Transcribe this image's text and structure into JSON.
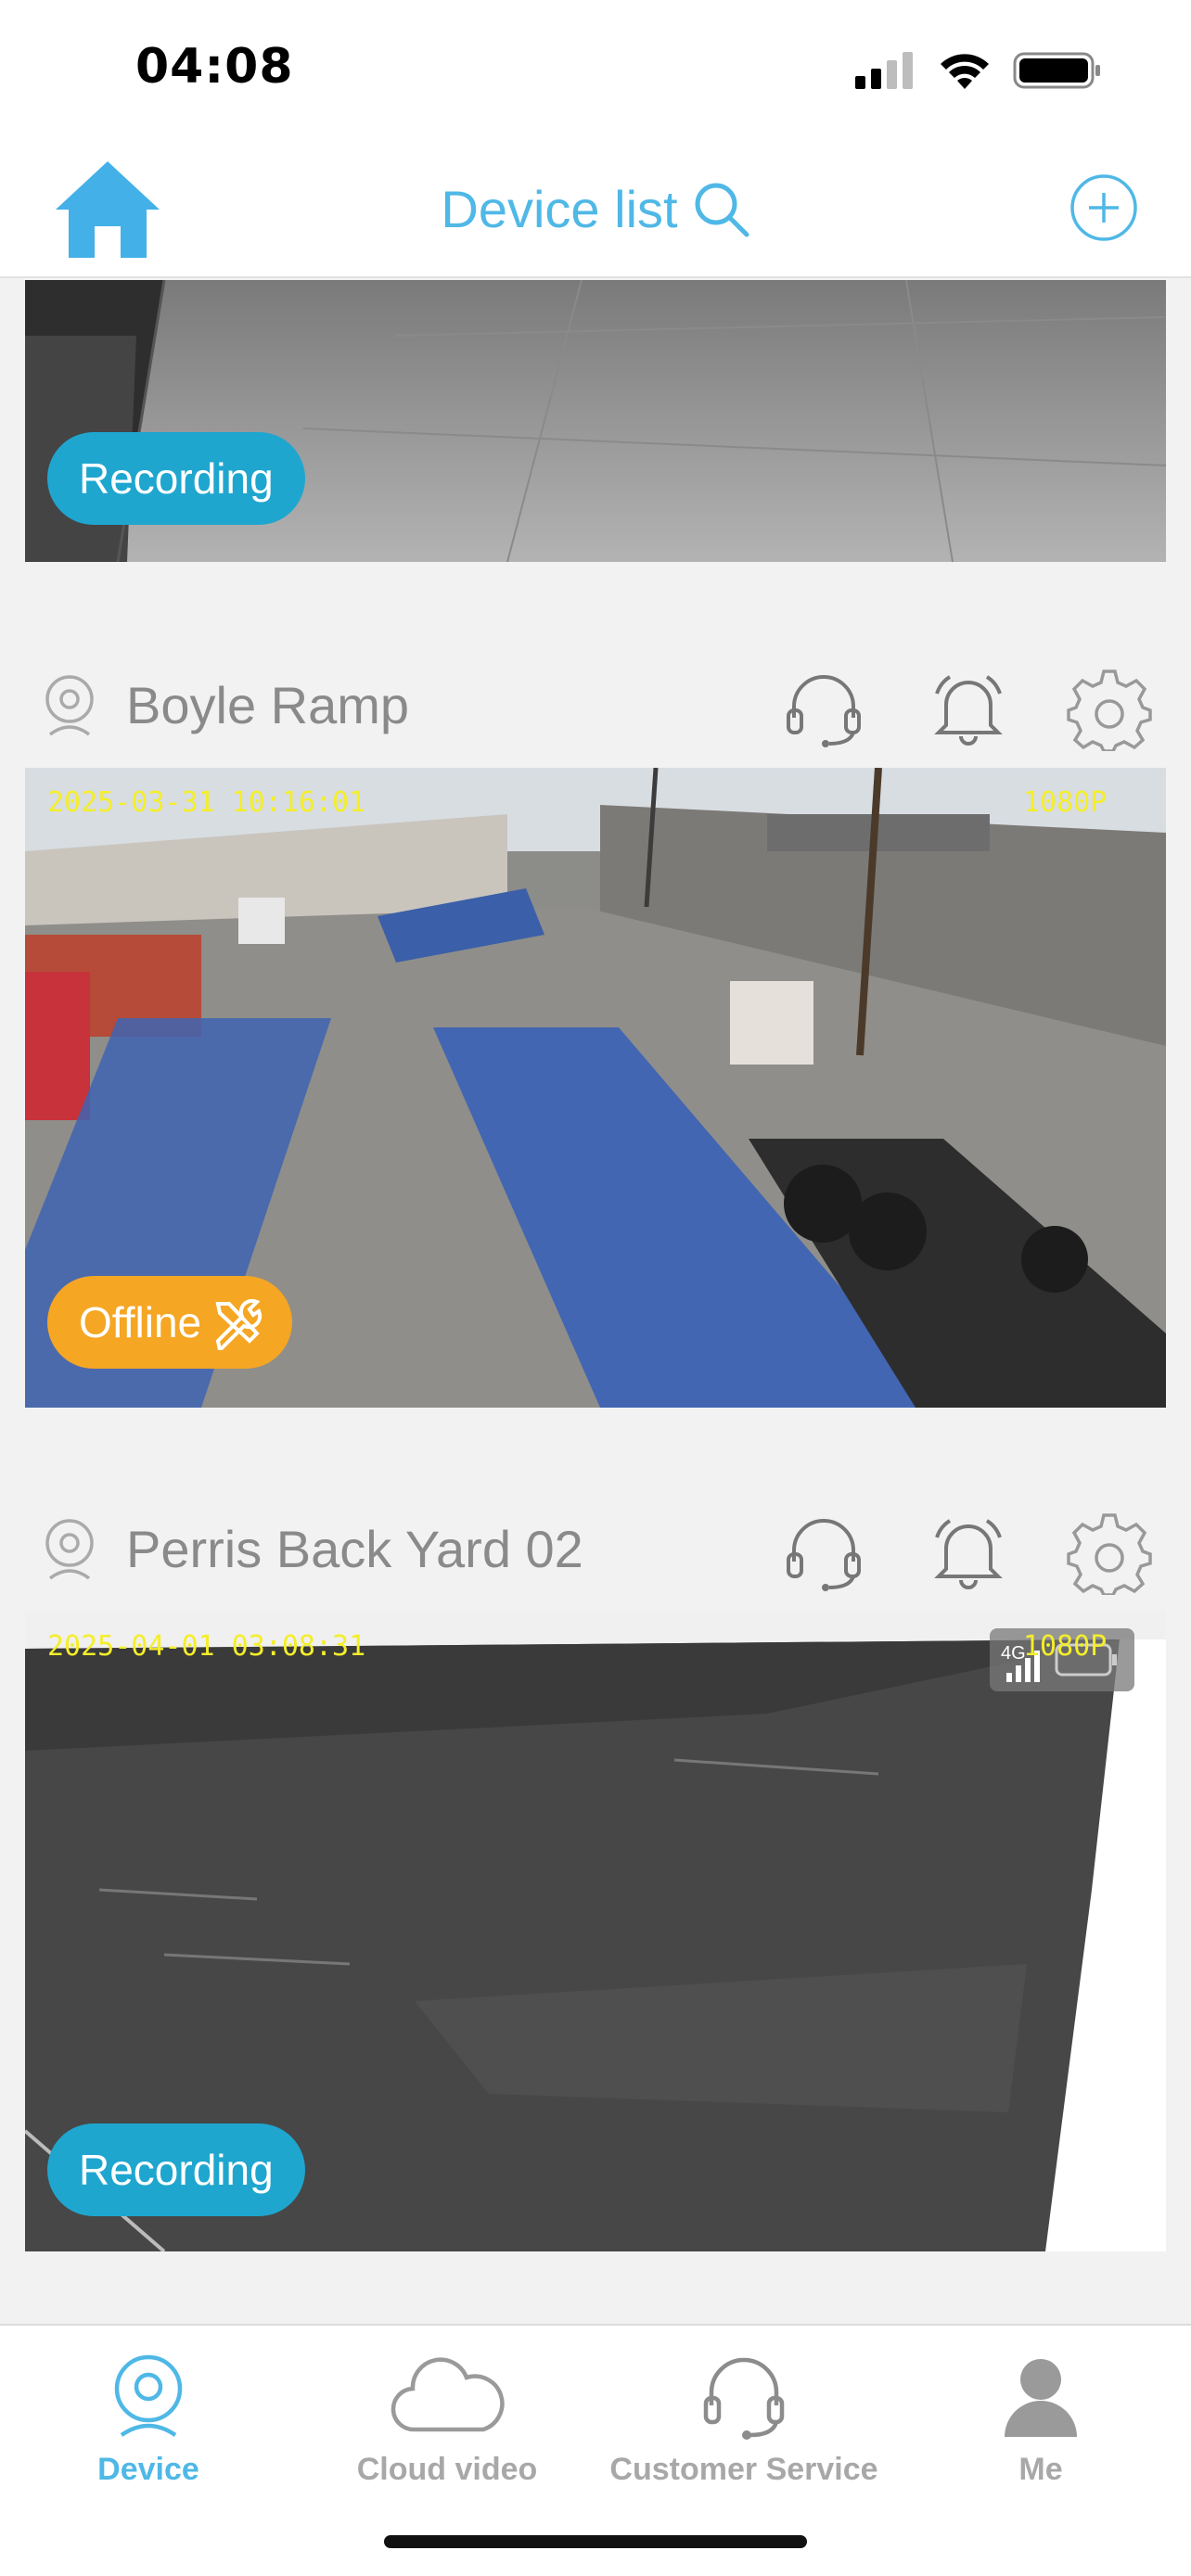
{
  "status_bar": {
    "time": "04:08"
  },
  "header": {
    "title": "Device list",
    "accent_color": "#4fb8e6",
    "home_icon": "home-icon",
    "search_icon": "search-icon",
    "add_icon": "add-circle-icon"
  },
  "devices": [
    {
      "name": "",
      "status": "Recording",
      "timestamp": "",
      "resolution": ""
    },
    {
      "name": "Boyle Ramp",
      "status": "Offline",
      "timestamp": "2025-03-31 10:16:01",
      "resolution": "1080P"
    },
    {
      "name": "Perris Back Yard 02",
      "status": "Recording",
      "timestamp": "2025-04-01 03:08:31",
      "resolution": "1080P",
      "network": "4G"
    }
  ],
  "row_actions": [
    "headset-icon",
    "bell-icon",
    "gear-icon"
  ],
  "status_colors": {
    "recording": "#1fa6cf",
    "offline": "#f5a623"
  },
  "tabs": [
    {
      "label": "Device",
      "icon": "camera-icon",
      "active": true
    },
    {
      "label": "Cloud video",
      "icon": "cloud-icon",
      "active": false
    },
    {
      "label": "Customer Service",
      "icon": "headset-icon",
      "active": false
    },
    {
      "label": "Me",
      "icon": "person-icon",
      "active": false
    }
  ]
}
